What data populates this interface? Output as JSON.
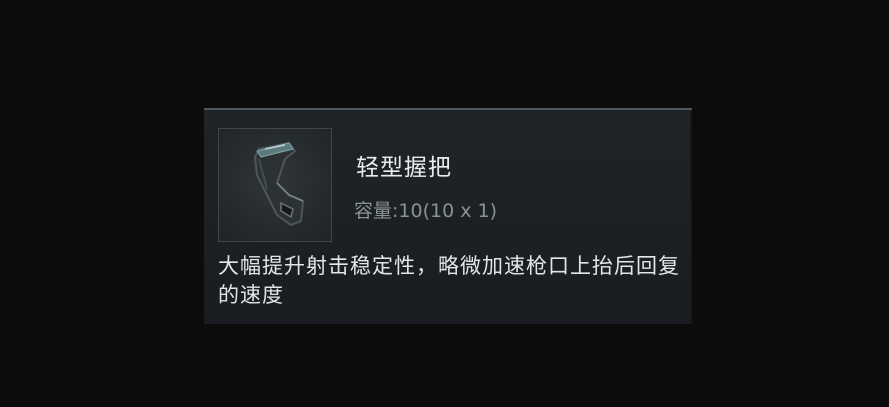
{
  "item": {
    "icon": "vertical-foregrip-icon",
    "name": "轻型握把",
    "capacity": "容量:10(10 x 1)",
    "description": "大幅提升射击稳定性，略微加速枪口上抬后回复的速度"
  },
  "colors": {
    "background": "#0c0c0c",
    "panel": "#1d2226",
    "title": "#e9ecee",
    "subtext": "#8b9296"
  }
}
